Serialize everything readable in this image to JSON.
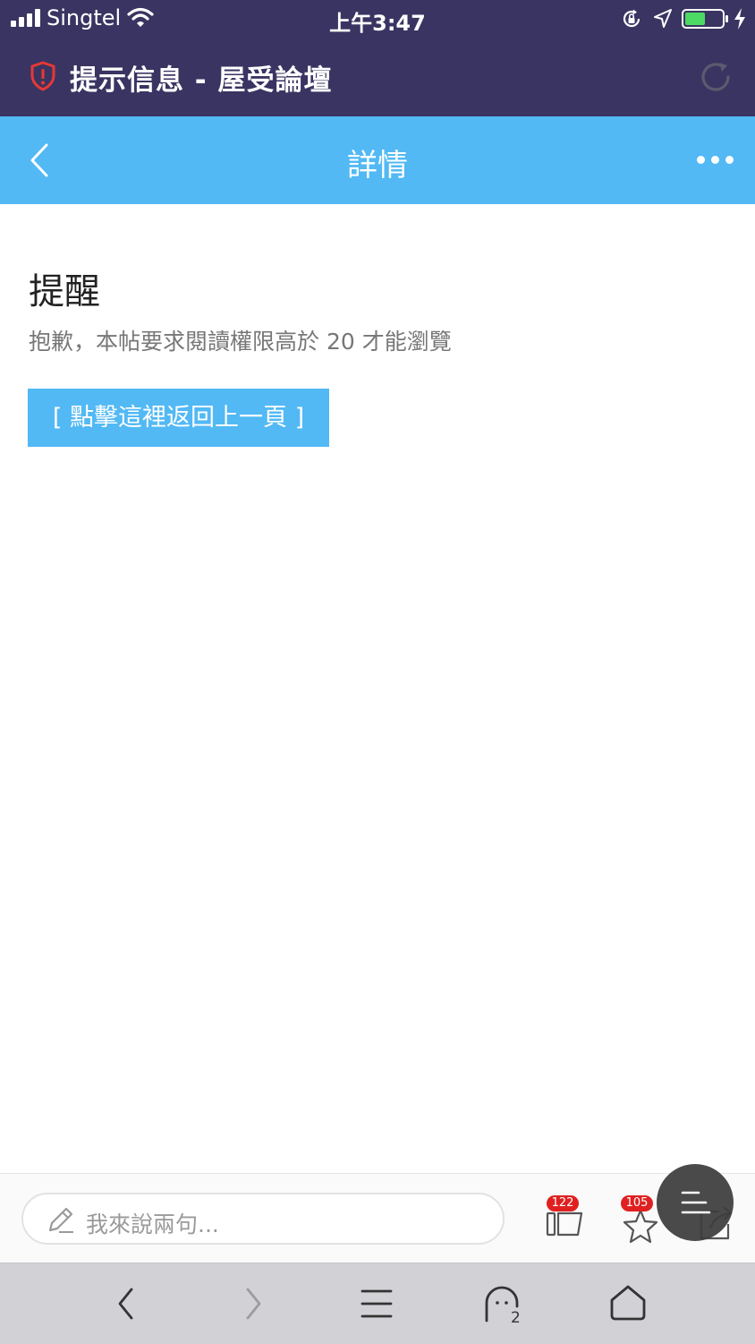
{
  "status_bar": {
    "carrier": "Singtel",
    "time": "上午3:47"
  },
  "browser": {
    "page_title": "提示信息 - 屋受論壇"
  },
  "app_header": {
    "title": "詳情"
  },
  "content": {
    "heading": "提醒",
    "message": "抱歉，本帖要求閱讀權限高於 20 才能瀏覽",
    "back_link": "[ 點擊這裡返回上一頁 ]"
  },
  "comment_bar": {
    "placeholder": "我來說兩句...",
    "reply_count": "122",
    "favorite_count": "105"
  },
  "toolbar": {
    "tabs_count": "2"
  },
  "colors": {
    "browser_bar": "#3a3462",
    "app_header": "#52b9f4",
    "button": "#52b9f4",
    "badge": "#e02020",
    "battery": "#4cd964"
  }
}
